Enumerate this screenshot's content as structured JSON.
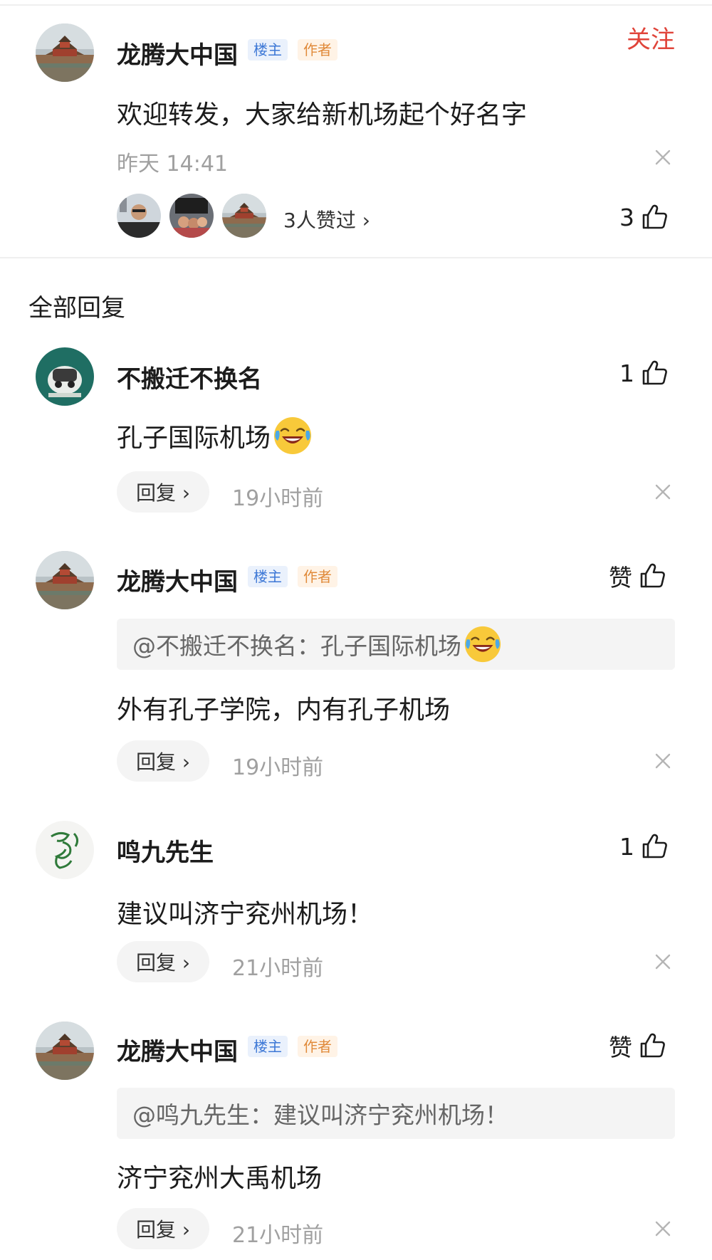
{
  "post": {
    "author": "龙腾大中国",
    "badge_owner": "楼主",
    "badge_author": "作者",
    "follow_label": "关注",
    "content": "欢迎转发，大家给新机场起个好名字",
    "time": "昨天  14:41",
    "liked_by_text": "3人赞过 ›",
    "like_count": "3"
  },
  "section_title": "全部回复",
  "reply_label": "回复 ›",
  "replies": [
    {
      "author": "不搬迁不换名",
      "content": "孔子国际机场",
      "time": "19小时前",
      "like_label": "1"
    },
    {
      "author": "龙腾大中国",
      "badge_owner": "楼主",
      "badge_author": "作者",
      "quote": "@不搬迁不换名：孔子国际机场",
      "content": "外有孔子学院，内有孔子机场",
      "time": "19小时前",
      "like_label": "赞"
    },
    {
      "author": "鸣九先生",
      "content": "建议叫济宁兖州机场！",
      "time": "21小时前",
      "like_label": "1"
    },
    {
      "author": "龙腾大中国",
      "badge_owner": "楼主",
      "badge_author": "作者",
      "quote": "@鸣九先生：建议叫济宁兖州机场！",
      "content": "济宁兖州大禹机场",
      "time": "21小时前",
      "like_label": "赞"
    }
  ],
  "colors": {
    "follow": "#e0443a",
    "badge_owner": "#3d78d6",
    "badge_author": "#e08a3a",
    "meta_gray": "#a0a0a0"
  }
}
